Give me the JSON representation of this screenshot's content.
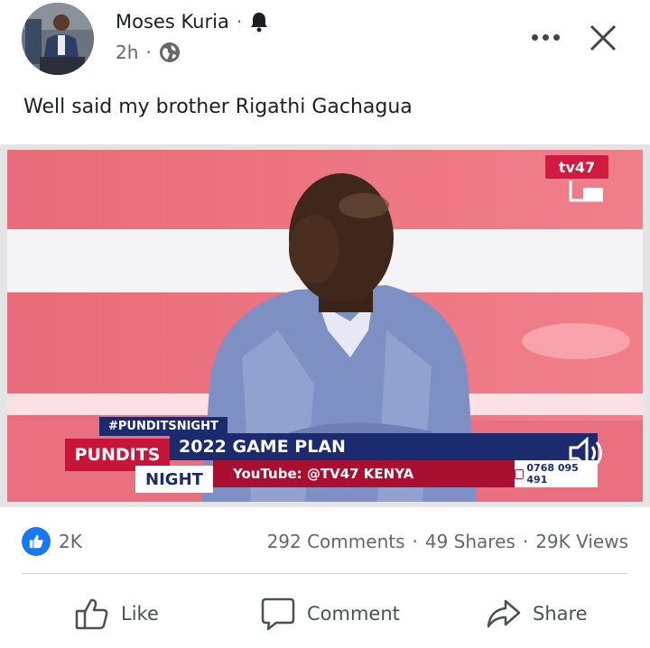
{
  "post": {
    "author": "Moses Kuria",
    "time": "2h",
    "text": "Well said my brother Rigathi Gachagua"
  },
  "video": {
    "hashtag": "#PUNDITSNIGHT",
    "show_line1": "PUNDITS",
    "show_line2": "NIGHT",
    "headline": "2022 GAME PLAN",
    "youtube": "YouTube: @TV47 KENYA",
    "phone": "0768 095 491",
    "channel_logo": "tv47"
  },
  "stats": {
    "reactions": "2K",
    "comments": "292 Comments",
    "shares": "49 Shares",
    "views": "29K Views",
    "separator": "·"
  },
  "actions": {
    "like": "Like",
    "comment": "Comment",
    "share": "Share"
  },
  "icons": {
    "bell": "bell-icon",
    "globe": "globe-icon",
    "more": "more-options-icon",
    "close": "close-icon",
    "like": "thumbs-up-icon",
    "comment": "comment-icon",
    "share": "share-icon",
    "sound": "speaker-icon",
    "pip": "picture-in-picture-icon"
  },
  "colors": {
    "brand_blue": "#1877f2",
    "text_secondary": "#65676b",
    "tv_red": "#c9143a",
    "tv_navy": "#1c2b6d"
  }
}
